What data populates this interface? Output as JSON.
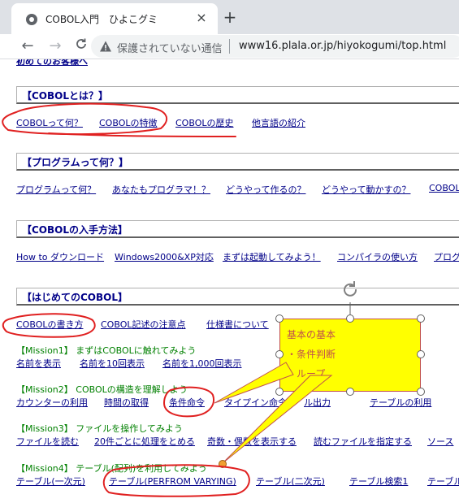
{
  "browser": {
    "tab_title": "COBOL入門　ひよこグミ",
    "tab_close": "×",
    "new_tab": "+",
    "back": "←",
    "forward": "→",
    "security_text": "保護されていない通信",
    "url": "www16.plala.or.jp/hiyokogumi/top.html"
  },
  "page": {
    "partial_top_link": "初めてのお客様へ",
    "sections": [
      {
        "header": "【COBOLとは？】",
        "links": [
          "COBOLって何？",
          "COBOLの特徴",
          "COBOLの歴史",
          "他言語の紹介"
        ]
      },
      {
        "header": "【プログラムって何？】",
        "links": [
          "プログラムって何？",
          "あなたもプログラマ！？",
          "どうやって作るの？",
          "どうやって動かすの？",
          "COBOL"
        ]
      },
      {
        "header": "【COBOLの入手方法】",
        "links": [
          "How to ダウンロード",
          "Windows2000&XP対応",
          "まずは起動してみよう！",
          "コンパイラの使い方",
          "プログ"
        ]
      },
      {
        "header": "【はじめてのCOBOL】",
        "links": [
          "COBOLの書き方",
          "COBOL記述の注意点",
          "仕様書について"
        ]
      }
    ],
    "missions": [
      {
        "title": "【Mission1】 まずはCOBOLに触れてみよう",
        "links": [
          "名前を表示",
          "名前を10回表示",
          "名前を1,000回表示"
        ]
      },
      {
        "title": "【Mission2】 COBOLの構造を理解しよう",
        "links": [
          "カウンターの利用",
          "時間の取得",
          "条件命令",
          "タイプイン命令",
          "ル出力",
          "テーブルの利用"
        ]
      },
      {
        "title": "【Mission3】 ファイルを操作してみよう",
        "links": [
          "ファイルを読む",
          "20件ごとに処理をとめる",
          "奇数・偶数を表示する",
          "読むファイルを指定する",
          "ソース"
        ]
      },
      {
        "title": "【Mission4】 テーブル(配列)を利用してみよう",
        "links": [
          "テーブル(一次元)",
          "テーブル(PERFROM VARYING)",
          "テーブル(二次元)",
          "テーブル検索1",
          "テーブル"
        ]
      }
    ]
  },
  "callout": {
    "lines": [
      "基本の基本",
      "・条件判断",
      "・ループ"
    ]
  },
  "colors": {
    "annotation_red": "#e02020",
    "callout_fill": "#ffff00",
    "link": "#000088",
    "mission": "#008000"
  }
}
